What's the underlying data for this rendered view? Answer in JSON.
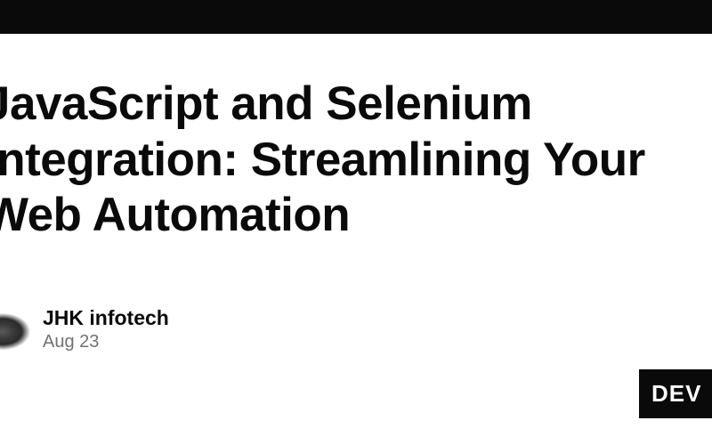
{
  "article": {
    "title": "JavaScript and Selenium Integration: Streamlining Your Web Automation",
    "author": "JHK infotech",
    "date": "Aug 23"
  },
  "badge": {
    "label": "DEV"
  }
}
